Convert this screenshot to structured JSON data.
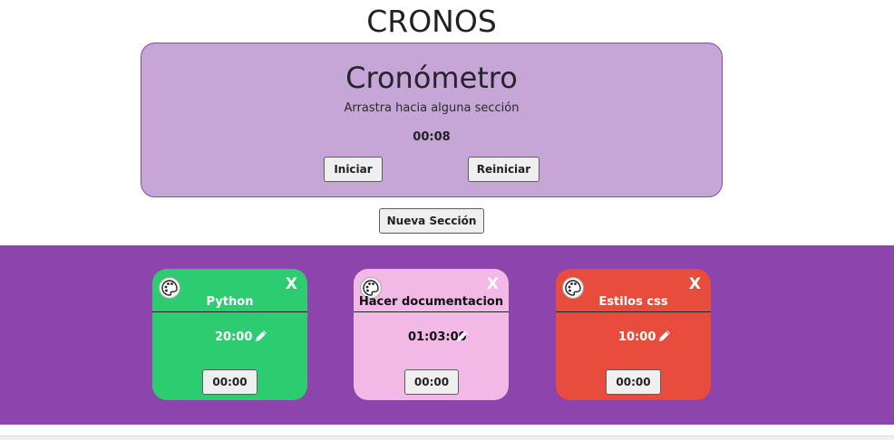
{
  "app": {
    "title": "CRONOS"
  },
  "stopwatch": {
    "heading": "Cronómetro",
    "hint": "Arrastra hacia alguna sección",
    "time": "00:08",
    "start_label": "Iniciar",
    "reset_label": "Reiniciar"
  },
  "new_section_label": "Nueva Sección",
  "colors": {
    "section_area": "#8e44ad",
    "stopwatch_card": "#c5a6d7"
  },
  "sections": [
    {
      "name": "Python",
      "goal": "20:00",
      "elapsed": "00:00",
      "color": "#2ecc71",
      "text_color": "#ffffff",
      "close": "X"
    },
    {
      "name": "Hacer documentacion",
      "goal": "01:03:00",
      "elapsed": "00:00",
      "color": "#f2b8e6",
      "text_color": "#111111",
      "close": "X"
    },
    {
      "name": "Estilos css",
      "goal": "10:00",
      "elapsed": "00:00",
      "color": "#e74c3c",
      "text_color": "#ffffff",
      "close": "X"
    }
  ],
  "icons": {
    "palette": "palette-icon",
    "edit": "pencil-icon",
    "close": "close-icon"
  }
}
